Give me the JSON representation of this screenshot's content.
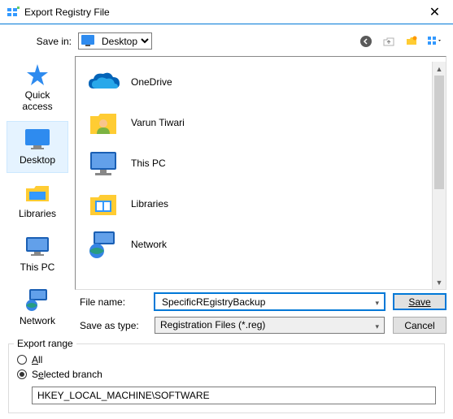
{
  "window": {
    "title": "Export Registry File"
  },
  "savein": {
    "label": "Save in:",
    "value": "Desktop"
  },
  "places": [
    {
      "key": "quick-access",
      "label": "Quick access"
    },
    {
      "key": "desktop",
      "label": "Desktop"
    },
    {
      "key": "libraries",
      "label": "Libraries"
    },
    {
      "key": "this-pc",
      "label": "This PC"
    },
    {
      "key": "network",
      "label": "Network"
    }
  ],
  "places_selected": "desktop",
  "files": [
    {
      "key": "onedrive",
      "label": "OneDrive"
    },
    {
      "key": "user",
      "label": "Varun Tiwari"
    },
    {
      "key": "thispc",
      "label": "This PC"
    },
    {
      "key": "libraries",
      "label": "Libraries"
    },
    {
      "key": "network",
      "label": "Network"
    }
  ],
  "filename": {
    "label": "File name:",
    "value": "SpecificREgistryBackup"
  },
  "saveastype": {
    "label": "Save as type:",
    "value": "Registration Files (*.reg)"
  },
  "buttons": {
    "save": "Save",
    "cancel": "Cancel"
  },
  "export": {
    "legend": "Export range",
    "all": "All",
    "selected": "Selected branch",
    "branch": "HKEY_LOCAL_MACHINE\\SOFTWARE",
    "choice": "selected"
  }
}
